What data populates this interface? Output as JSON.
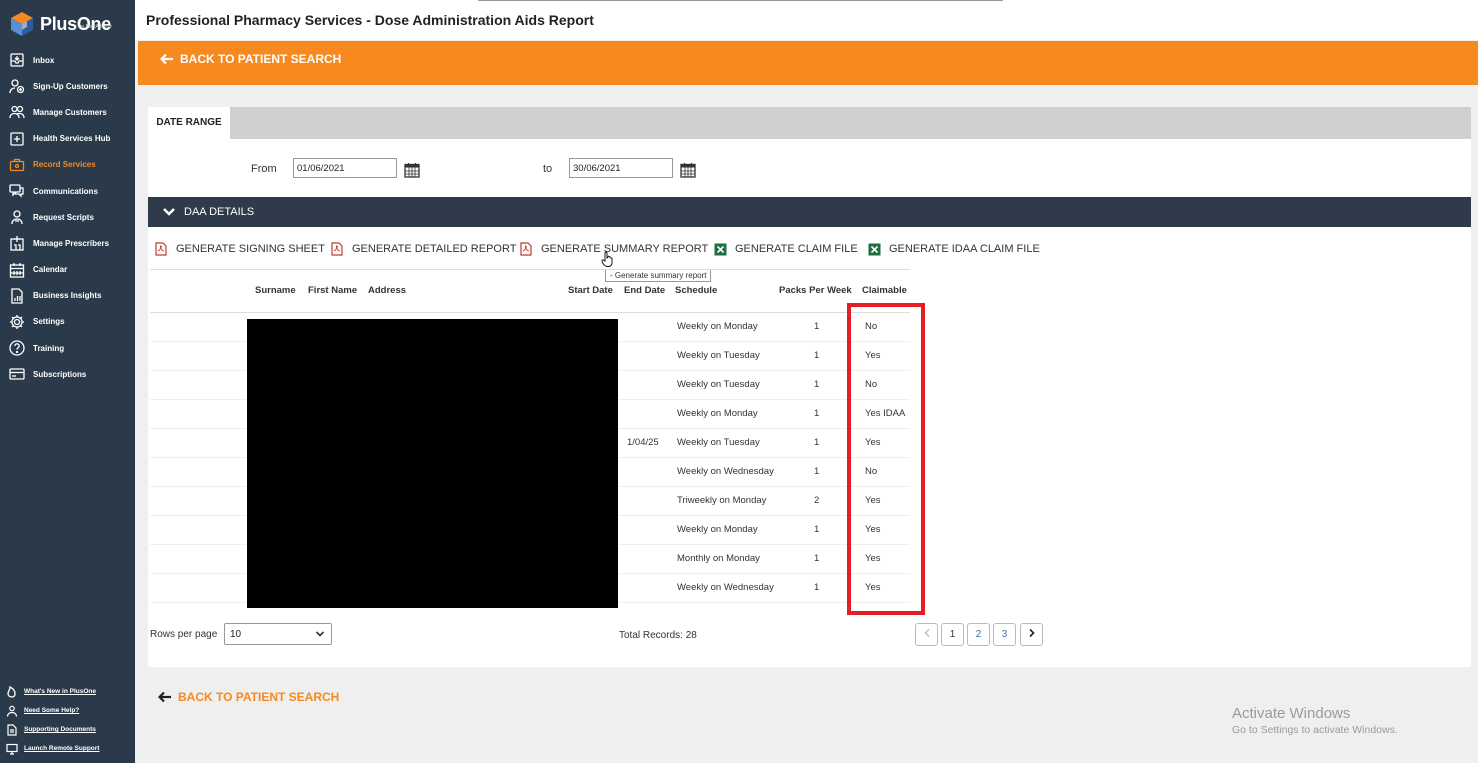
{
  "app": {
    "logo_text": "PlusOne",
    "logo_sub": "by MedAdvisor",
    "page_title": "Professional Pharmacy Services - Dose Administration Aids Report",
    "back_label": "BACK TO PATIENT SEARCH",
    "accent_color": "#f7891f",
    "sidebar_color": "#2b3a4a"
  },
  "sidebar": {
    "items": [
      {
        "label": "Inbox",
        "icon": "inbox-icon"
      },
      {
        "label": "Sign-Up Customers",
        "icon": "user-add-icon"
      },
      {
        "label": "Manage Customers",
        "icon": "users-icon"
      },
      {
        "label": "Health Services Hub",
        "icon": "medical-icon"
      },
      {
        "label": "Record Services",
        "icon": "briefcase-icon"
      },
      {
        "label": "Communications",
        "icon": "chat-icon"
      },
      {
        "label": "Request Scripts",
        "icon": "script-icon"
      },
      {
        "label": "Manage Prescribers",
        "icon": "hospital-icon"
      },
      {
        "label": "Calendar",
        "icon": "calendar-icon"
      },
      {
        "label": "Business Insights",
        "icon": "insights-icon"
      },
      {
        "label": "Settings",
        "icon": "gear-icon"
      },
      {
        "label": "Training",
        "icon": "question-icon"
      },
      {
        "label": "Subscriptions",
        "icon": "card-icon"
      }
    ],
    "active_item": "Record Services",
    "footer": [
      {
        "label": "What's New in PlusOne",
        "icon": "flame-icon"
      },
      {
        "label": "Need Some Help?",
        "icon": "person-help-icon"
      },
      {
        "label": "Supporting Documents",
        "icon": "document-icon"
      },
      {
        "label": "Launch Remote Support",
        "icon": "monitor-icon"
      }
    ]
  },
  "date_range": {
    "tab_label": "DATE RANGE",
    "from_label": "From",
    "from_value": "01/06/2021",
    "to_label": "to",
    "to_value": "30/06/2021"
  },
  "daa": {
    "section_label": "DAA DETAILS",
    "actions": [
      {
        "label": "GENERATE SIGNING SHEET",
        "icon": "pdf-icon"
      },
      {
        "label": "GENERATE DETAILED REPORT",
        "icon": "pdf-icon"
      },
      {
        "label": "GENERATE SUMMARY REPORT",
        "icon": "pdf-icon"
      },
      {
        "label": "GENERATE CLAIM FILE",
        "icon": "excel-icon"
      },
      {
        "label": "GENERATE IDAA CLAIM FILE",
        "icon": "excel-icon"
      }
    ],
    "tooltip": "- Generate summary report",
    "columns": {
      "surname": "Surname",
      "first_name": "First Name",
      "address": "Address",
      "start_date": "Start Date",
      "end_date": "End Date",
      "schedule": "Schedule",
      "packs": "Packs Per Week",
      "claimable": "Claimable"
    },
    "rows": [
      {
        "end_date": "",
        "schedule": "Weekly on Monday",
        "packs": "1",
        "claimable": "No"
      },
      {
        "end_date": "",
        "schedule": "Weekly on Tuesday",
        "packs": "1",
        "claimable": "Yes"
      },
      {
        "end_date": "",
        "schedule": "Weekly on Tuesday",
        "packs": "1",
        "claimable": "No"
      },
      {
        "end_date": "",
        "schedule": "Weekly on Monday",
        "packs": "1",
        "claimable": "Yes IDAA"
      },
      {
        "end_date": "1/04/25",
        "schedule": "Weekly on Tuesday",
        "packs": "1",
        "claimable": "Yes"
      },
      {
        "end_date": "",
        "schedule": "Weekly on Wednesday",
        "packs": "1",
        "claimable": "No"
      },
      {
        "end_date": "",
        "schedule": "Triweekly on Monday",
        "packs": "2",
        "claimable": "Yes"
      },
      {
        "end_date": "",
        "schedule": "Weekly on Monday",
        "packs": "1",
        "claimable": "Yes"
      },
      {
        "end_date": "",
        "schedule": "Monthly on Monday",
        "packs": "1",
        "claimable": "Yes"
      },
      {
        "end_date": "",
        "schedule": "Weekly on Wednesday",
        "packs": "1",
        "claimable": "Yes"
      }
    ]
  },
  "pagination": {
    "rows_per_page_label": "Rows per page",
    "rows_per_page_value": "10",
    "total_records": "Total Records: 28",
    "pages": [
      "1",
      "2",
      "3"
    ],
    "current_page": "1"
  },
  "watermark": {
    "title": "Activate Windows",
    "subtitle": "Go to Settings to activate Windows."
  }
}
